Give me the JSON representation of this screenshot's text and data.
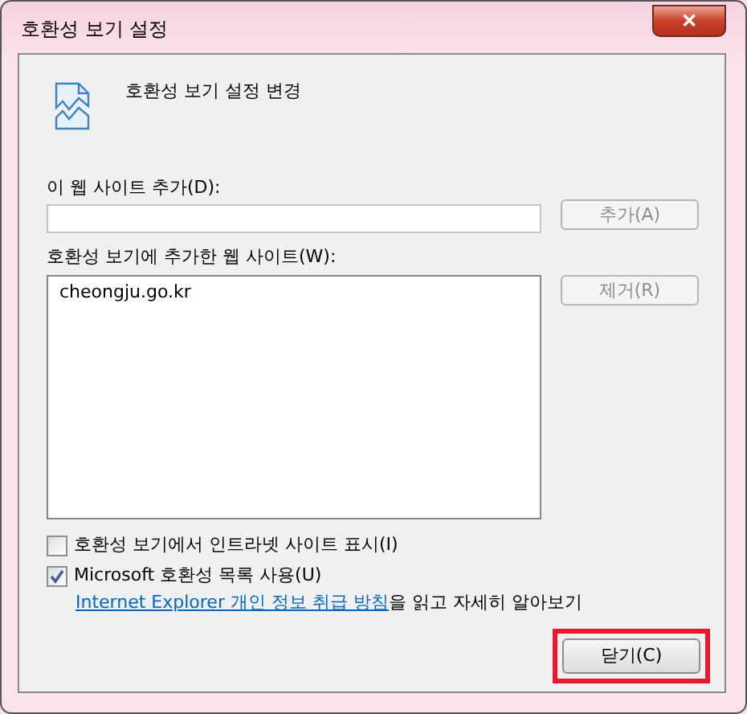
{
  "window": {
    "title": "호환성 보기 설정",
    "close_label": "✕"
  },
  "header": {
    "title": "호환성 보기 설정 변경"
  },
  "add_site": {
    "label": "이 웹 사이트 추가(D):",
    "button": {
      "label": "추가(A)",
      "disabled": true
    }
  },
  "site_list": {
    "label": "호환성 보기에 추가한 웹 사이트(W):",
    "items": [
      {
        "text": "cheongju.go.kr",
        "selected": false
      }
    ],
    "button": {
      "label": "제거(R)",
      "disabled": true
    }
  },
  "options": [
    {
      "label": "호환성 보기에서 인트라넷 사이트 표시(I)",
      "checked": false
    },
    {
      "label": "Microsoft 호환성 목록 사용(U)",
      "checked": true
    }
  ],
  "privacy_note": {
    "link": "Internet Explorer 개인 정보 취급 방침",
    "text": "을 읽고 자세히 알아보기"
  },
  "close_button": {
    "label": "닫기(C)",
    "disabled": false,
    "highlighted": true
  }
}
